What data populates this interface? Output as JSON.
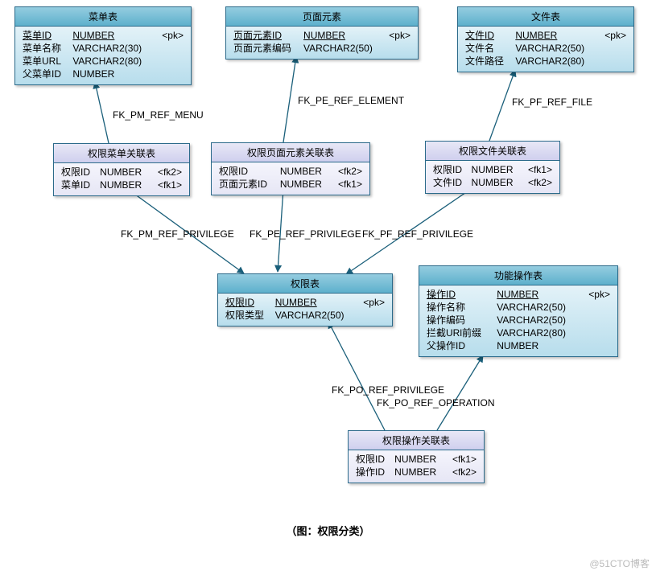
{
  "entities": {
    "menu": {
      "title": "菜单表",
      "cols": [
        {
          "name": "菜单ID",
          "type": "NUMBER",
          "key": "<pk>",
          "pk": true
        },
        {
          "name": "菜单名称",
          "type": "VARCHAR2(30)",
          "key": ""
        },
        {
          "name": "菜单URL",
          "type": "VARCHAR2(80)",
          "key": ""
        },
        {
          "name": "父菜单ID",
          "type": "NUMBER",
          "key": ""
        }
      ]
    },
    "page_elem": {
      "title": "页面元素",
      "cols": [
        {
          "name": "页面元素ID",
          "type": "NUMBER",
          "key": "<pk>",
          "pk": true
        },
        {
          "name": "页面元素编码",
          "type": "VARCHAR2(50)",
          "key": ""
        }
      ]
    },
    "file": {
      "title": "文件表",
      "cols": [
        {
          "name": "文件ID",
          "type": "NUMBER",
          "key": "<pk>",
          "pk": true
        },
        {
          "name": "文件名",
          "type": "VARCHAR2(50)",
          "key": ""
        },
        {
          "name": "文件路径",
          "type": "VARCHAR2(80)",
          "key": ""
        }
      ]
    },
    "priv_menu": {
      "title": "权限菜单关联表",
      "cols": [
        {
          "name": "权限ID",
          "type": "NUMBER",
          "key": "<fk2>"
        },
        {
          "name": "菜单ID",
          "type": "NUMBER",
          "key": "<fk1>"
        }
      ]
    },
    "priv_page": {
      "title": "权限页面元素关联表",
      "cols": [
        {
          "name": "权限ID",
          "type": "NUMBER",
          "key": "<fk2>"
        },
        {
          "name": "页面元素ID",
          "type": "NUMBER",
          "key": "<fk1>"
        }
      ]
    },
    "priv_file": {
      "title": "权限文件关联表",
      "cols": [
        {
          "name": "权限ID",
          "type": "NUMBER",
          "key": "<fk1>"
        },
        {
          "name": "文件ID",
          "type": "NUMBER",
          "key": "<fk2>"
        }
      ]
    },
    "priv": {
      "title": "权限表",
      "cols": [
        {
          "name": "权限ID",
          "type": "NUMBER",
          "key": "<pk>",
          "pk": true
        },
        {
          "name": "权限类型",
          "type": "VARCHAR2(50)",
          "key": ""
        }
      ]
    },
    "op": {
      "title": "功能操作表",
      "cols": [
        {
          "name": "操作ID",
          "type": "NUMBER",
          "key": "<pk>",
          "pk": true
        },
        {
          "name": "操作名称",
          "type": "VARCHAR2(50)",
          "key": ""
        },
        {
          "name": "操作编码",
          "type": "VARCHAR2(50)",
          "key": ""
        },
        {
          "name": "拦截URl前缀",
          "type": "VARCHAR2(80)",
          "key": ""
        },
        {
          "name": "父操作ID",
          "type": "NUMBER",
          "key": ""
        }
      ]
    },
    "priv_op": {
      "title": "权限操作关联表",
      "cols": [
        {
          "name": "权限ID",
          "type": "NUMBER",
          "key": "<fk1>"
        },
        {
          "name": "操作ID",
          "type": "NUMBER",
          "key": "<fk2>"
        }
      ]
    }
  },
  "fk_labels": {
    "pm_menu": "FK_PM_REF_MENU",
    "pe_elem": "FK_PE_REF_ELEMENT",
    "pf_file": "FK_PF_REF_FILE",
    "pm_priv": "FK_PM_REF_PRIVILEGE",
    "pe_priv": "FK_PE_REF_PRIVILEGE",
    "pf_priv": "FK_PF_REF_PRIVILEGE",
    "po_priv": "FK_PO_REF_PRIVILEGE",
    "po_op": "FK_PO_REF_OPERATION"
  },
  "caption": "（图：权限分类）",
  "watermark": "@51CTO博客"
}
